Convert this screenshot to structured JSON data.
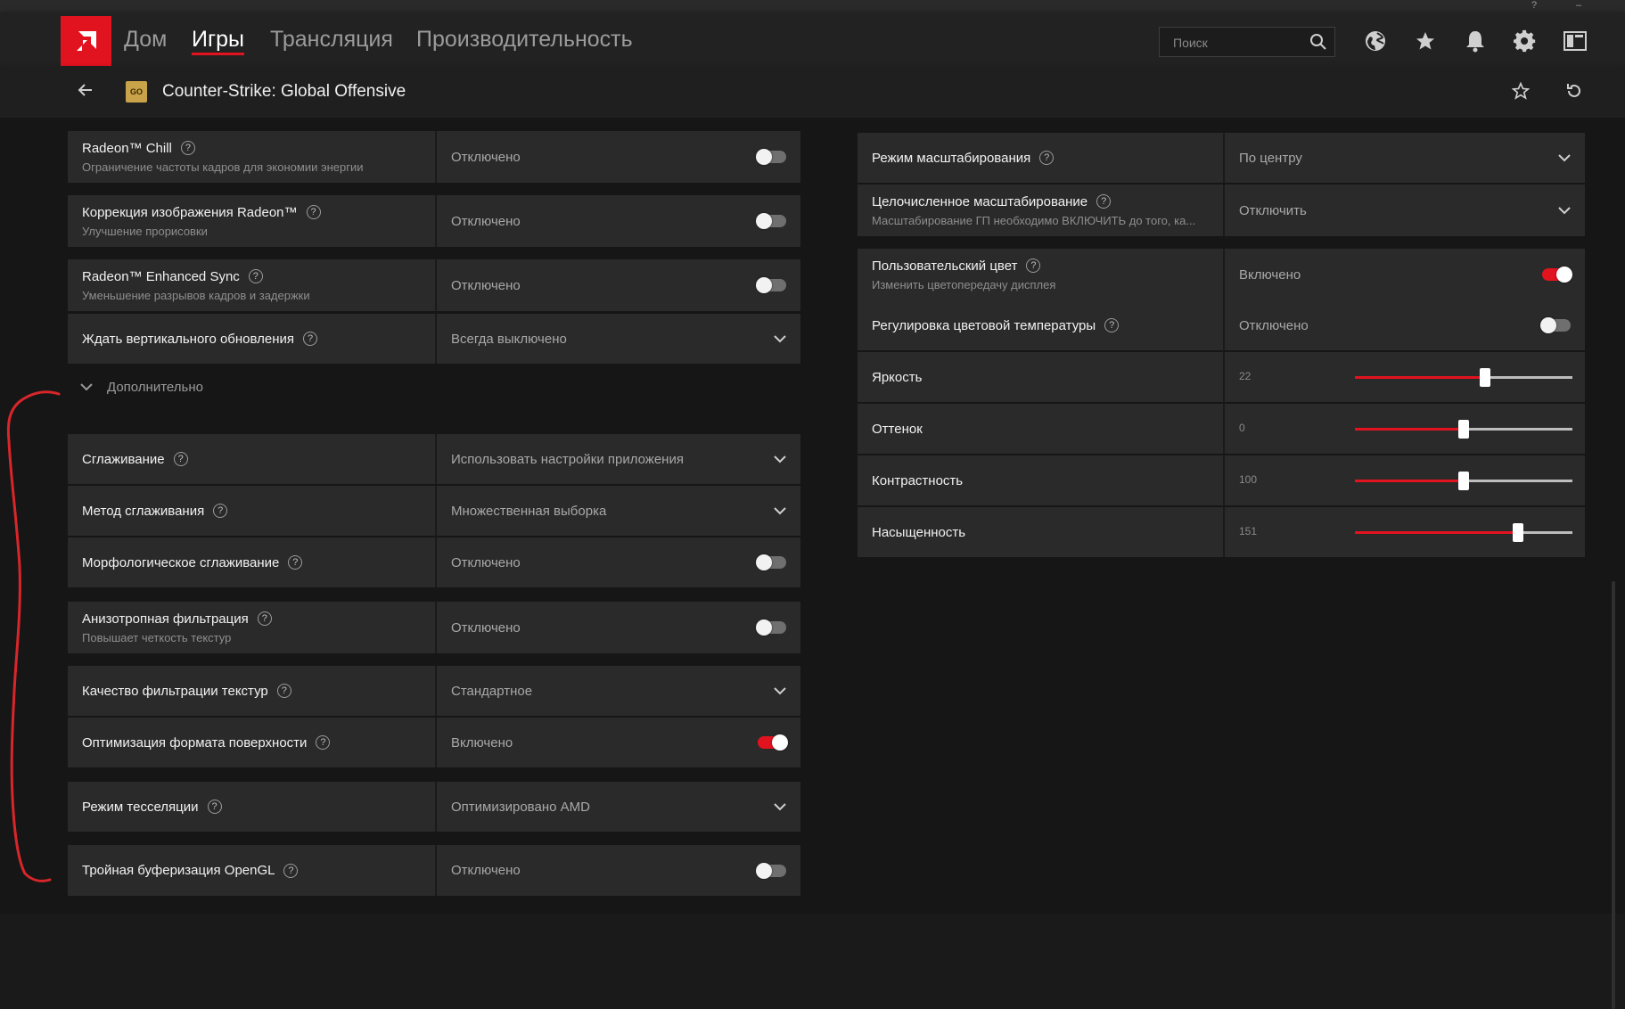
{
  "window": {
    "help_glyph": "?",
    "minimize_glyph": "–"
  },
  "nav": {
    "home": "Дом",
    "games": "Игры",
    "streaming": "Трансляция",
    "performance": "Производительность"
  },
  "search": {
    "placeholder": "Поиск"
  },
  "game": {
    "title": "Counter-Strike: Global Offensive",
    "icon_text": "GO"
  },
  "left_rows": [
    {
      "title": "Radeon™ Chill",
      "subtitle": "Ограничение частоты кадров для экономии энергии",
      "value": "Отключено",
      "control": "toggle-off"
    },
    {
      "title": "Коррекция изображения Radeon™",
      "subtitle": "Улучшение прорисовки",
      "value": "Отключено",
      "control": "toggle-off"
    },
    {
      "title": "Radeon™ Enhanced Sync",
      "subtitle": "Уменьшение разрывов кадров и задержки",
      "value": "Отключено",
      "control": "toggle-off"
    },
    {
      "title": "Ждать вертикального обновления",
      "subtitle": "",
      "value": "Всегда выключено",
      "control": "dropdown"
    },
    {
      "title": "Сглаживание",
      "subtitle": "",
      "value": "Использовать настройки приложения",
      "control": "dropdown"
    },
    {
      "title": "Метод сглаживания",
      "subtitle": "",
      "value": "Множественная выборка",
      "control": "dropdown"
    },
    {
      "title": "Морфологическое сглаживание",
      "subtitle": "",
      "value": "Отключено",
      "control": "toggle-off"
    },
    {
      "title": "Анизотропная фильтрация",
      "subtitle": "Повышает четкость текстур",
      "value": "Отключено",
      "control": "toggle-off"
    },
    {
      "title": "Качество фильтрации текстур",
      "subtitle": "",
      "value": "Стандартное",
      "control": "dropdown"
    },
    {
      "title": "Оптимизация формата поверхности",
      "subtitle": "",
      "value": "Включено",
      "control": "toggle-on"
    },
    {
      "title": "Режим тесселяции",
      "subtitle": "",
      "value": "Оптимизировано AMD",
      "control": "dropdown"
    },
    {
      "title": "Тройная буферизация OpenGL",
      "subtitle": "",
      "value": "Отключено",
      "control": "toggle-off"
    }
  ],
  "advanced": {
    "label": "Дополнительно"
  },
  "right_rows": [
    {
      "title": "Режим масштабирования",
      "subtitle": "",
      "value": "По центру",
      "control": "dropdown"
    },
    {
      "title": "Целочисленное масштабирование",
      "subtitle": "Масштабирование ГП необходимо ВКЛЮЧИТЬ до того, ка...",
      "value": "Отключить",
      "control": "dropdown"
    },
    {
      "title": "Пользовательский цвет",
      "subtitle": "Изменить цветопередачу дисплея",
      "value": "Включено",
      "control": "toggle-on"
    },
    {
      "title": "Регулировка цветовой температуры",
      "subtitle": "",
      "value": "Отключено",
      "control": "toggle-off"
    },
    {
      "title": "Яркость",
      "subtitle": "",
      "value": "22",
      "control": "slider",
      "level": 0.6
    },
    {
      "title": "Оттенок",
      "subtitle": "",
      "value": "0",
      "control": "slider",
      "level": 0.5
    },
    {
      "title": "Контрастность",
      "subtitle": "",
      "value": "100",
      "control": "slider",
      "level": 0.5
    },
    {
      "title": "Насыщенность",
      "subtitle": "",
      "value": "151",
      "control": "slider",
      "level": 0.75
    }
  ],
  "colors": {
    "accent": "#e1131f",
    "row_bg": "#2a2a2a",
    "annotation": "#d8262a"
  }
}
